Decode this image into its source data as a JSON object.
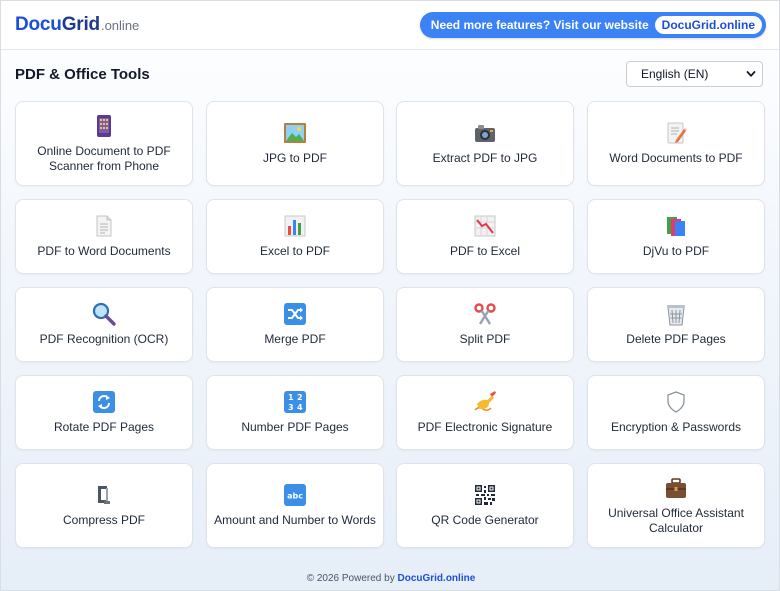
{
  "header": {
    "logo_main": "Docu",
    "logo_grid": "Grid",
    "logo_sub": ".online",
    "promo_text": "Need more features? Visit our website",
    "promo_badge": "DocuGrid.online"
  },
  "toolbar": {
    "title": "PDF & Office Tools",
    "language": "English (EN)"
  },
  "tools": [
    {
      "label": "Online Document to PDF Scanner from Phone",
      "icon": "phone-scanner-icon"
    },
    {
      "label": "JPG to PDF",
      "icon": "picture-icon"
    },
    {
      "label": "Extract PDF to JPG",
      "icon": "camera-icon"
    },
    {
      "label": "Word Documents to PDF",
      "icon": "memo-icon"
    },
    {
      "label": "PDF to Word Documents",
      "icon": "page-icon"
    },
    {
      "label": "Excel to PDF",
      "icon": "bar-chart-icon"
    },
    {
      "label": "PDF to Excel",
      "icon": "chart-decreasing-icon"
    },
    {
      "label": "DjVu to PDF",
      "icon": "books-icon"
    },
    {
      "label": "PDF Recognition (OCR)",
      "icon": "magnifier-icon"
    },
    {
      "label": "Merge PDF",
      "icon": "shuffle-icon"
    },
    {
      "label": "Split PDF",
      "icon": "scissors-icon"
    },
    {
      "label": "Delete PDF Pages",
      "icon": "wastebasket-icon"
    },
    {
      "label": "Rotate PDF Pages",
      "icon": "rotate-icon"
    },
    {
      "label": "Number PDF Pages",
      "icon": "numbers-icon"
    },
    {
      "label": "PDF Electronic Signature",
      "icon": "writing-hand-icon"
    },
    {
      "label": "Encryption & Passwords",
      "icon": "shield-icon"
    },
    {
      "label": "Compress PDF",
      "icon": "clamp-icon"
    },
    {
      "label": "Amount and Number to Words",
      "icon": "abc-icon"
    },
    {
      "label": "QR Code Generator",
      "icon": "qr-code-icon"
    },
    {
      "label": "Universal Office Assistant Calculator",
      "icon": "briefcase-icon"
    }
  ],
  "footer": {
    "text": "© 2026 Powered by",
    "link": "DocuGrid.online"
  }
}
